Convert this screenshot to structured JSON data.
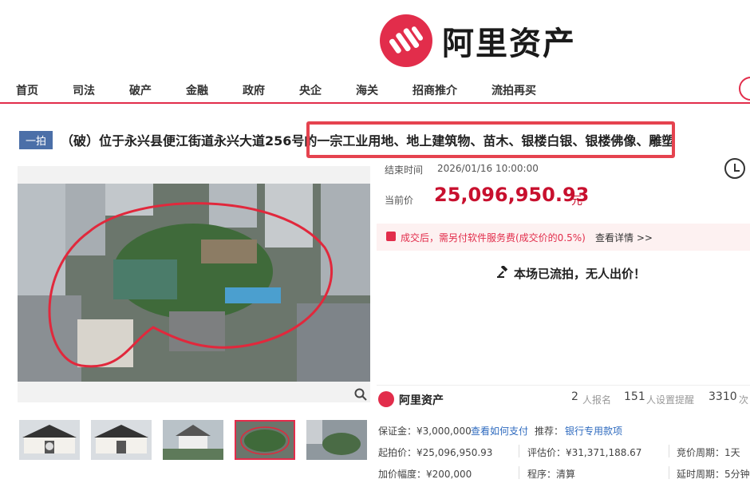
{
  "brand": {
    "name": "阿里资产",
    "color": "#e22d4b"
  },
  "nav": {
    "items": [
      "首页",
      "司法",
      "破产",
      "金融",
      "政府",
      "央企",
      "海关",
      "招商推介",
      "流拍再买"
    ]
  },
  "lot": {
    "round_badge": "一拍",
    "title": "（破）位于永兴县便江街道永兴大道256号的一宗工业用地、地上建筑物、苗木、银楼白银、银楼佛像、雕塑"
  },
  "auction": {
    "end_label": "结束时间",
    "end_time": "2026/01/16 10:00:00",
    "price_label": "当前价",
    "current_price": "25,096,950.93",
    "price_unit": "元",
    "fee_notice": "成交后，需另付软件服务费(成交价的0.5%)",
    "fee_link": "查看详情 >>",
    "status": "本场已流拍，无人出价！"
  },
  "seller": {
    "name": "阿里资产",
    "signups": "2",
    "signups_label": "人报名",
    "reminders": "151",
    "reminders_label": "人设置提醒",
    "views": "3310",
    "views_label": "次"
  },
  "details": {
    "deposit": "保证金：¥3,000,000",
    "deposit_link": "查看如何支付",
    "recommend_label": "推荐：",
    "recommend_link": "银行专用款项",
    "start_price": "起拍价：¥25,096,950.93",
    "assessed_price": "评估价：¥31,371,188.67",
    "bid_cycle": "竞价周期：1天",
    "increment": "加价幅度：¥200,000",
    "procedure": "程序：清算",
    "delay_cycle": "延时周期：5分钟"
  },
  "icons": {
    "zoom": "zoom-icon",
    "alarm": "alarm-clock-icon",
    "gavel": "gavel-icon",
    "fee": "wallet-icon"
  }
}
